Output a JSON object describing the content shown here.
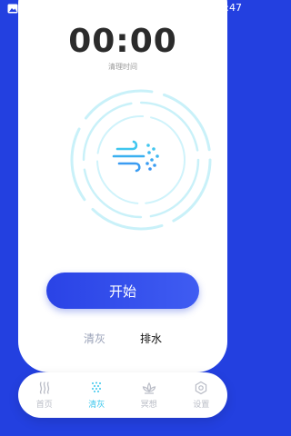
{
  "status_bar": {
    "time": "8:47",
    "left_icon": "gallery-icon"
  },
  "timer": {
    "value": "00:00",
    "caption": "清理时间"
  },
  "center_icon": "wind-icon",
  "start_button": {
    "label": "开始"
  },
  "mode_toggle": {
    "options": [
      "清灰",
      "排水"
    ],
    "selected": "排水"
  },
  "bottom_nav": {
    "items": [
      {
        "label": "首页",
        "icon": "home-waves-icon"
      },
      {
        "label": "清灰",
        "icon": "dust-dots-icon"
      },
      {
        "label": "冥想",
        "icon": "lotus-icon"
      },
      {
        "label": "设置",
        "icon": "gear-icon"
      }
    ],
    "active": "清灰"
  },
  "colors": {
    "background": "#2340e0",
    "accent": "#38c6ec",
    "ring": "#c9f1f9",
    "card": "#ffffff"
  }
}
